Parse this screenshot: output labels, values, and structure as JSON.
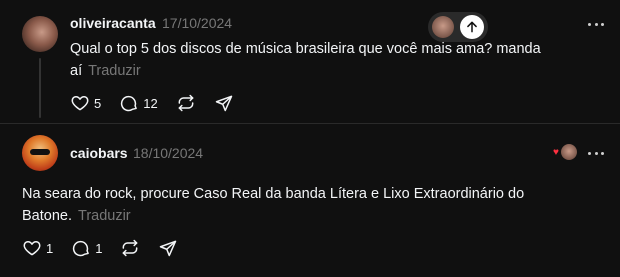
{
  "posts": [
    {
      "username": "oliveiracanta",
      "date": "17/10/2024",
      "text": "Qual o top 5 dos discos de música brasileira que você mais ama? manda aí",
      "translate": "Traduzir",
      "likes": "5",
      "replies": "12"
    },
    {
      "username": "caiobars",
      "date": "18/10/2024",
      "text": "Na seara do rock, procure Caso Real da banda Lítera e Lixo Extraordinário do Batone.",
      "translate": "Traduzir",
      "likes": "1",
      "replies": "1"
    }
  ],
  "icons": {
    "like": "heart-icon",
    "reply": "comment-icon",
    "repost": "repost-icon",
    "share": "send-icon",
    "more": "more-options-icon",
    "scroll_up": "arrow-up-icon",
    "liked_by_author": "heart-icon"
  },
  "colors": {
    "background": "#101010",
    "text": "#f3f5f7",
    "muted": "#777777",
    "liked_heart": "#ff3040"
  }
}
